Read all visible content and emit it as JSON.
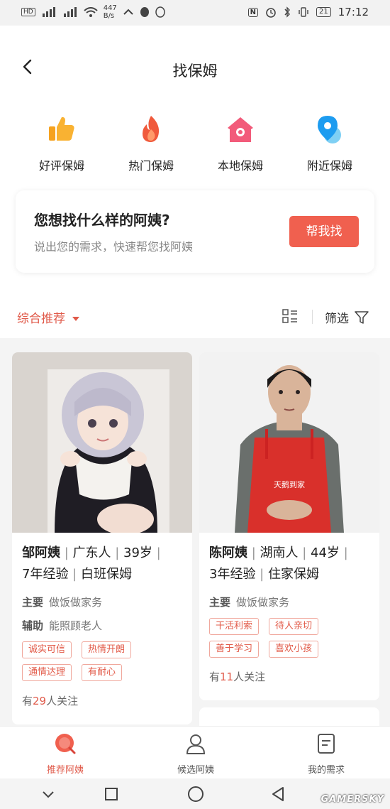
{
  "status": {
    "carrier": "HD",
    "speed": "447",
    "speed_unit": "B/s",
    "battery": "21",
    "time": "17:12"
  },
  "title": "找保姆",
  "categories": [
    {
      "label": "好评保姆",
      "icon": "thumbs-up-icon"
    },
    {
      "label": "热门保姆",
      "icon": "fire-icon"
    },
    {
      "label": "本地保姆",
      "icon": "home-icon"
    },
    {
      "label": "附近保姆",
      "icon": "location-pin-icon"
    }
  ],
  "ask": {
    "question": "您想找什么样的阿姨?",
    "desc": "说出您的需求，快速帮您找阿姨",
    "button": "帮我找"
  },
  "sort": {
    "label": "综合推荐",
    "filter": "筛选"
  },
  "cards": [
    {
      "name": "邹阿姨",
      "origin": "广东人",
      "age": "39岁",
      "experience": "7年经验",
      "type": "白班保姆",
      "main_key": "主要",
      "main_val": "做饭做家务",
      "aux_key": "辅助",
      "aux_val": "能照顾老人",
      "tags": [
        "诚实可信",
        "热情开朗",
        "通情达理",
        "有耐心"
      ],
      "fans_prefix": "有",
      "fans": "29",
      "fans_suffix": "人关注"
    },
    {
      "name": "陈阿姨",
      "origin": "湖南人",
      "age": "44岁",
      "experience": "3年经验",
      "type": "住家保姆",
      "main_key": "主要",
      "main_val": "做饭做家务",
      "tags": [
        "干活利索",
        "待人亲切",
        "善于学习",
        "喜欢小孩"
      ],
      "fans_prefix": "有",
      "fans": "11",
      "fans_suffix": "人关注"
    }
  ],
  "tabs": [
    {
      "label": "推荐阿姨",
      "icon": "search-icon",
      "active": true
    },
    {
      "label": "候选阿姨",
      "icon": "person-icon",
      "active": false
    },
    {
      "label": "我的需求",
      "icon": "document-icon",
      "active": false
    }
  ],
  "watermark": "GAMERSKY",
  "colors": {
    "accent": "#e05a4a",
    "button": "#f0604f"
  }
}
